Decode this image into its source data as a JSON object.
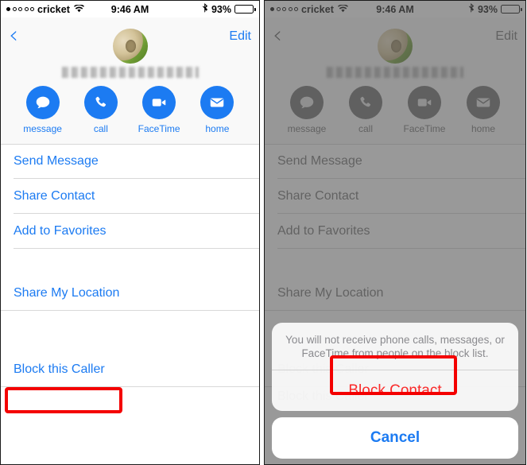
{
  "status_bar": {
    "carrier": "cricket",
    "signal_dots_total": 5,
    "signal_dots_filled": 1,
    "wifi_icon": "wifi-icon",
    "time": "9:46 AM",
    "bluetooth_icon": "bluetooth-icon",
    "battery_percent": "93%",
    "battery_level": 93
  },
  "nav": {
    "back_icon": "chevron-left-icon",
    "edit_label": "Edit"
  },
  "contact": {
    "name": "",
    "name_redacted": true,
    "avatar_icon": "contact-avatar"
  },
  "quick_actions": [
    {
      "label": "message",
      "icon": "message-bubble-icon"
    },
    {
      "label": "call",
      "icon": "phone-icon"
    },
    {
      "label": "FaceTime",
      "icon": "video-camera-icon"
    },
    {
      "label": "home",
      "icon": "envelope-icon"
    }
  ],
  "list_rows": [
    {
      "label": "Send Message"
    },
    {
      "label": "Share Contact"
    },
    {
      "label": "Add to Favorites"
    },
    {
      "label": "Share My Location"
    },
    {
      "label": "Block this Caller"
    }
  ],
  "action_sheet": {
    "message": "You will not receive phone calls, messages, or FaceTime from people on the block list.",
    "destructive_label": "Block Contact",
    "cancel_label": "Cancel",
    "behind_label": "Block this Caller"
  },
  "highlights": {
    "left_target": "Block this Caller",
    "right_target": "Block Contact",
    "color": "#f40000"
  },
  "colors": {
    "tint_blue": "#1c7bf2",
    "destructive_red": "#fa2b2b",
    "highlight_red": "#f40000",
    "dimmed_gray": "#6f6f6f"
  }
}
